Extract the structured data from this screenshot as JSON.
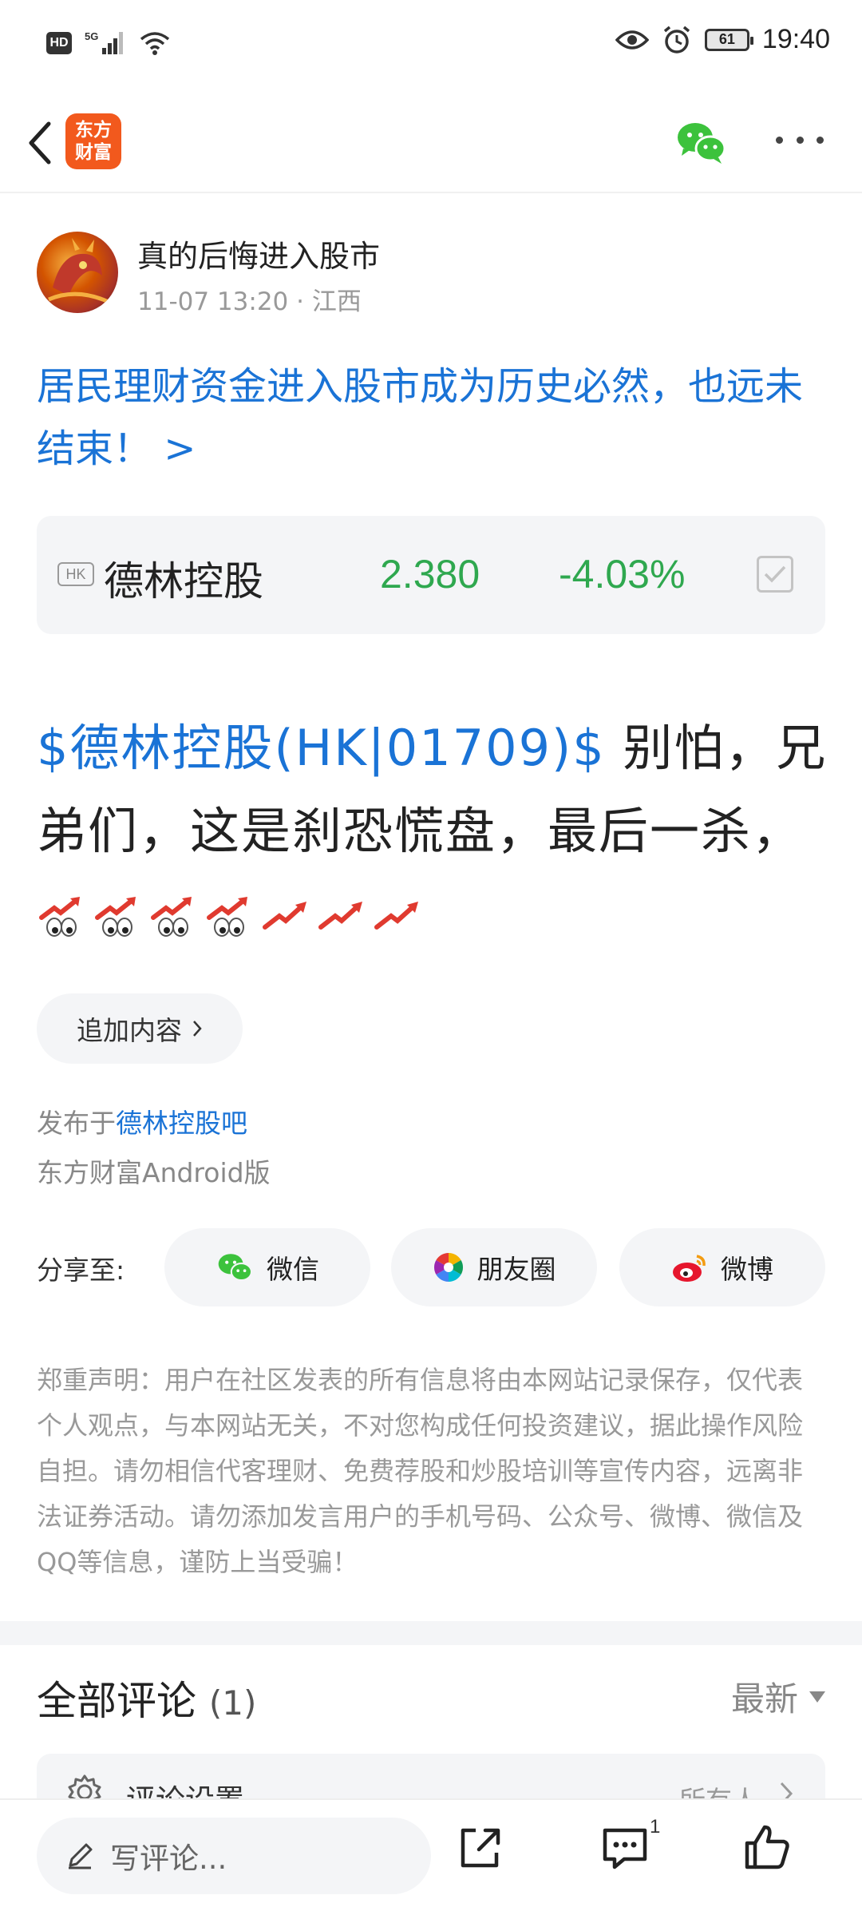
{
  "status_bar": {
    "hd": "HD",
    "network": "5G",
    "battery": "61",
    "time": "19:40"
  },
  "nav": {
    "logo_line1": "东方",
    "logo_line2": "财富"
  },
  "author": {
    "name": "真的后悔进入股市",
    "time": "11-07 13:20",
    "location": "江西"
  },
  "headline": "居民理财资金进入股市成为历史必然，也远未结束！ >",
  "stock": {
    "market": "HK",
    "name": "德林控股",
    "price": "2.380",
    "change": "-4.03%",
    "color": "#2fa84f"
  },
  "post": {
    "tag": "$德林控股(HK|01709)$",
    "text": " 别怕，兄弟们，这是刹恐慌盘，最后一杀，",
    "emojis": [
      "eyes-chart-up",
      "eyes-chart-up",
      "eyes-chart-up",
      "eyes-chart-up",
      "chart-up-arrow",
      "chart-up-arrow",
      "chart-up-arrow"
    ]
  },
  "append_button": "追加内容",
  "published": {
    "prefix": "发布于",
    "bar": "德林控股吧",
    "client": "东方财富Android版"
  },
  "share": {
    "label": "分享至:",
    "wechat": "微信",
    "moments": "朋友圈",
    "weibo": "微博"
  },
  "disclaimer": "郑重声明：用户在社区发表的所有信息将由本网站记录保存，仅代表个人观点，与本网站无关，不对您构成任何投资建议，据此操作风险自担。请勿相信代客理财、免费荐股和炒股培训等宣传内容，远离非法证券活动。请勿添加发言用户的手机号码、公众号、微博、微信及QQ等信息，谨防上当受骗！",
  "comments": {
    "title": "全部评论",
    "count": "(1)",
    "sort": "最新",
    "settings_label": "评论设置",
    "settings_value": "所有人"
  },
  "bottom_bar": {
    "placeholder": "写评论...",
    "comment_count": "1"
  },
  "colors": {
    "link_blue": "#1a73d6",
    "stock_green": "#2fa84f",
    "brand_orange": "#f2591d"
  }
}
